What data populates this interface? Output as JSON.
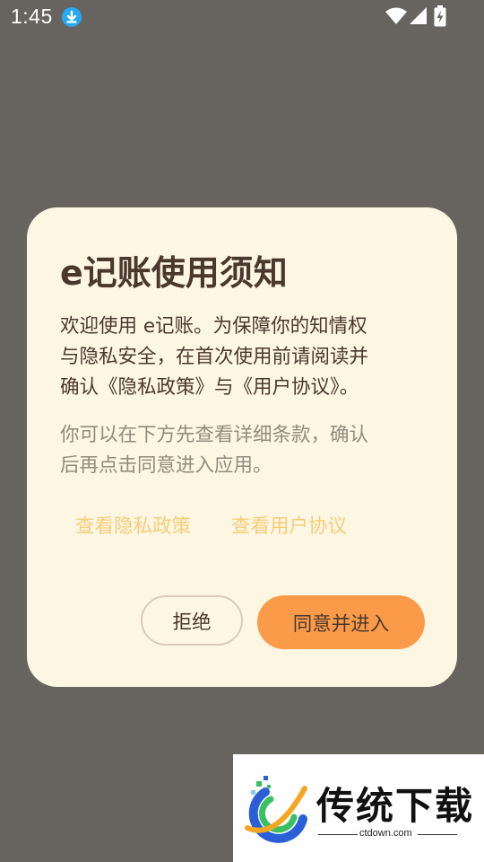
{
  "status_bar": {
    "time": "1:45",
    "icons": [
      "download-icon",
      "wifi-icon",
      "signal-icon",
      "battery-charging-icon"
    ]
  },
  "dialog": {
    "title": "e记账使用须知",
    "body_line1": "欢迎使用 e记账。为保障你的知情权",
    "body_line2": "与隐私安全，在首次使用前请阅读并",
    "body_line3": "确认《隐私政策》与《用户协议》。",
    "secondary_line1": "你可以在下方先查看详细条款，确认",
    "secondary_line2": "后再点击同意进入应用。",
    "privacy_link": "查看隐私政策",
    "agreement_link": "查看用户协议",
    "reject_button": "拒绝",
    "agree_button": "同意并进入"
  },
  "watermark": {
    "title": "传统下载",
    "url": "ctdown.com"
  },
  "colors": {
    "background": "#676460",
    "dialog": "#fdf6e3",
    "text_primary": "#4a382d",
    "text_secondary": "#948a7d",
    "link": "#f4cd7a",
    "accent": "#fb9b4a"
  }
}
